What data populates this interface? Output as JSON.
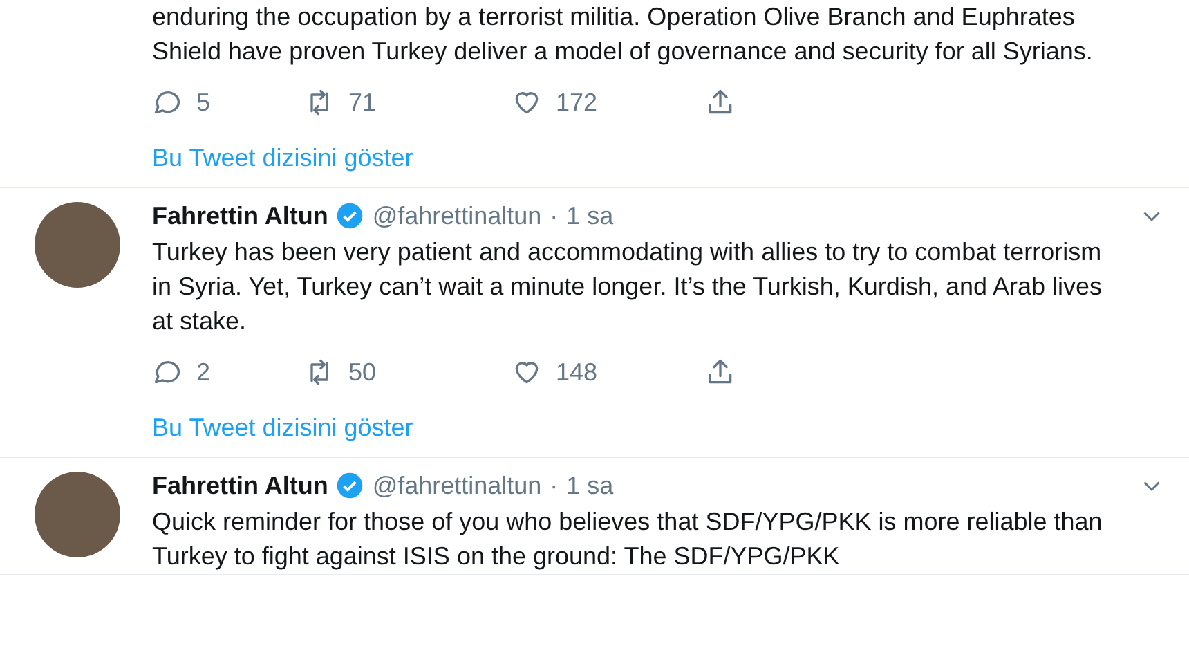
{
  "tweets": [
    {
      "text": "enduring the occupation by a terrorist militia. Operation Olive Branch and Euphrates Shield have proven Turkey deliver a model of governance and security for all Syrians.",
      "replies": "5",
      "retweets": "71",
      "likes": "172",
      "thread_link": "Bu Tweet dizisini göster"
    },
    {
      "author": {
        "name": "Fahrettin Altun",
        "verified": true,
        "handle": "@fahrettinaltun",
        "separator": "·",
        "time": "1 sa"
      },
      "text": "Turkey has been very patient and accommodating with allies to try to combat terrorism in Syria. Yet, Turkey can’t wait a minute longer. It’s the Turkish, Kurdish, and Arab lives at stake.",
      "replies": "2",
      "retweets": "50",
      "likes": "148",
      "thread_link": "Bu Tweet dizisini göster"
    },
    {
      "author": {
        "name": "Fahrettin Altun",
        "verified": true,
        "handle": "@fahrettinaltun",
        "separator": "·",
        "time": "1 sa"
      },
      "text": "Quick reminder for those of you who believes that SDF/YPG/PKK is more reliable than Turkey to fight against ISIS on the ground: The SDF/YPG/PKK"
    }
  ]
}
